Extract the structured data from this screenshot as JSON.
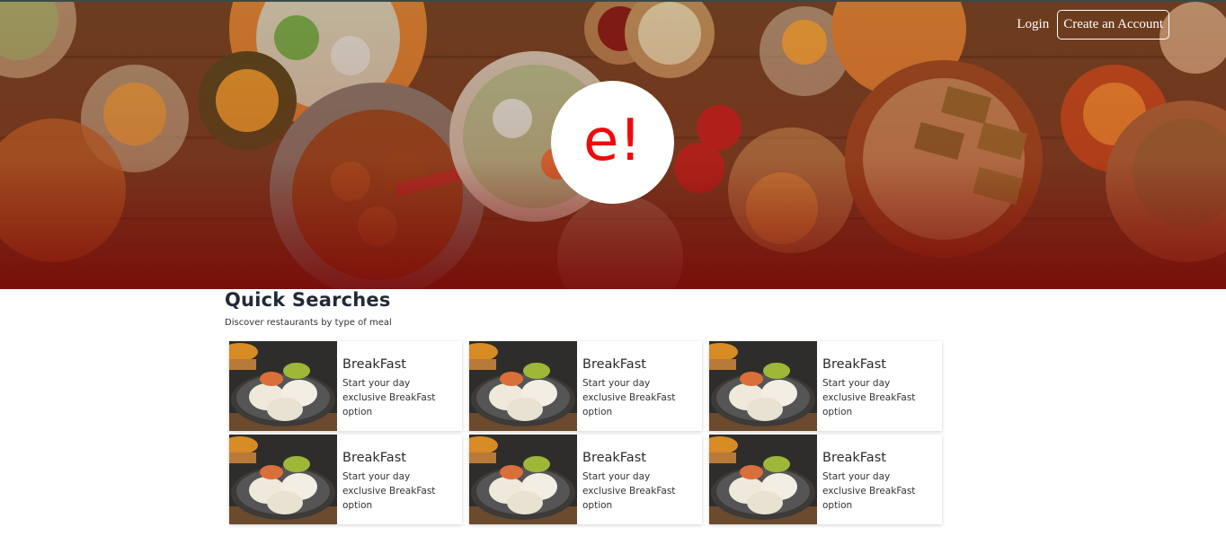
{
  "nav": {
    "login_label": "Login",
    "create_account_label": "Create an Account"
  },
  "logo": {
    "text": "e!"
  },
  "quick_searches": {
    "title": "Quick Searches",
    "subtitle": "Discover restaurants by type of meal",
    "cards": [
      {
        "title": "BreakFast",
        "description": "Start your day exclusive BreakFast option"
      },
      {
        "title": "BreakFast",
        "description": "Start your day exclusive BreakFast option"
      },
      {
        "title": "BreakFast",
        "description": "Start your day exclusive BreakFast option"
      },
      {
        "title": "BreakFast",
        "description": "Start your day exclusive BreakFast option"
      },
      {
        "title": "BreakFast",
        "description": "Start your day exclusive BreakFast option"
      },
      {
        "title": "BreakFast",
        "description": "Start your day exclusive BreakFast option"
      }
    ]
  },
  "colors": {
    "logo_red": "#ef0b0b",
    "hero_bottom": "#760505",
    "title_text": "#222a36"
  }
}
